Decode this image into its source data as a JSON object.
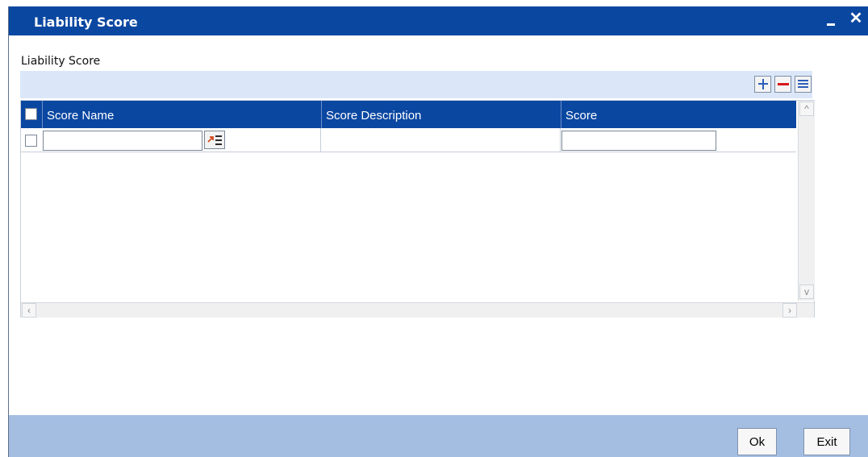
{
  "window": {
    "title": "Liability Score"
  },
  "section": {
    "label": "Liability Score"
  },
  "toolbar": {
    "add_icon": "plus-icon",
    "delete_icon": "minus-icon",
    "view_icon": "list-icon"
  },
  "grid": {
    "columns": [
      {
        "label": "Score Name"
      },
      {
        "label": "Score Description"
      },
      {
        "label": "Score"
      }
    ],
    "row": {
      "score_name_value": "",
      "score_description_value": "",
      "score_value": ""
    }
  },
  "buttons": {
    "ok": "Ok",
    "exit": "Exit"
  },
  "colors": {
    "titlebar": "#0a47a1",
    "toolbar_strip": "#dbe7f8",
    "bottom_bar": "#a4bee2"
  }
}
